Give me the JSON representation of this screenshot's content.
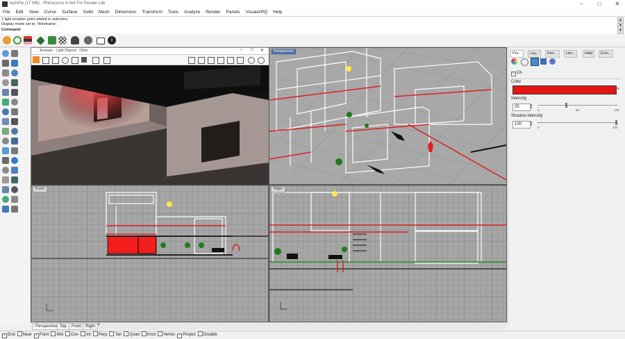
{
  "window": {
    "title": "layhiHa (17 MB) - Rhinoceros 6 Not For Resale Lab",
    "minimize": "–",
    "maximize": "□",
    "close": "✕"
  },
  "menu": [
    "File",
    "Edit",
    "View",
    "Curve",
    "Surface",
    "Solid",
    "Mesh",
    "Dimension",
    "Transform",
    "Tools",
    "Analyze",
    "Render",
    "Panels",
    "VisualARQ",
    "Help"
  ],
  "command": {
    "history": [
      "1 light location point added to selection.",
      "Display mode set to: 'Wireframe'."
    ],
    "prompt": "Command:"
  },
  "render_window": {
    "title": "Arranger - Light Objects : Other",
    "buttons": [
      "–",
      "□",
      "✕"
    ]
  },
  "viewports": {
    "top_right": "Perspective",
    "bottom_left": "Front",
    "bottom_right": "Right"
  },
  "bottom_tabs": [
    "Perspective",
    "Top",
    "Front",
    "Right"
  ],
  "add_tab": "+",
  "panel": {
    "tabs": [
      "Pro...",
      "Lay...",
      "Ren...",
      "Libr...",
      "Help",
      "Envi..."
    ],
    "on_label": "On",
    "color_label": "Color",
    "color_value": "#e51515",
    "intensity_label": "Intensity",
    "intensity_value": "35",
    "intensity_ticks": [
      "0",
      "50",
      "100"
    ],
    "shadow_label": "Shadow intensity",
    "shadow_value": "100",
    "shadow_ticks": [
      "0",
      "100"
    ]
  },
  "osnaps": [
    {
      "label": "End",
      "checked": true
    },
    {
      "label": "Near",
      "checked": false
    },
    {
      "label": "Point",
      "checked": true
    },
    {
      "label": "Mid",
      "checked": false
    },
    {
      "label": "Cen",
      "checked": false
    },
    {
      "label": "Int",
      "checked": false
    },
    {
      "label": "Perp",
      "checked": false
    },
    {
      "label": "Tan",
      "checked": false
    },
    {
      "label": "Quad",
      "checked": false
    },
    {
      "label": "Knot",
      "checked": false
    },
    {
      "label": "Vertex",
      "checked": false
    },
    {
      "label": "Project",
      "checked": true
    },
    {
      "label": "Disable",
      "checked": false
    }
  ]
}
